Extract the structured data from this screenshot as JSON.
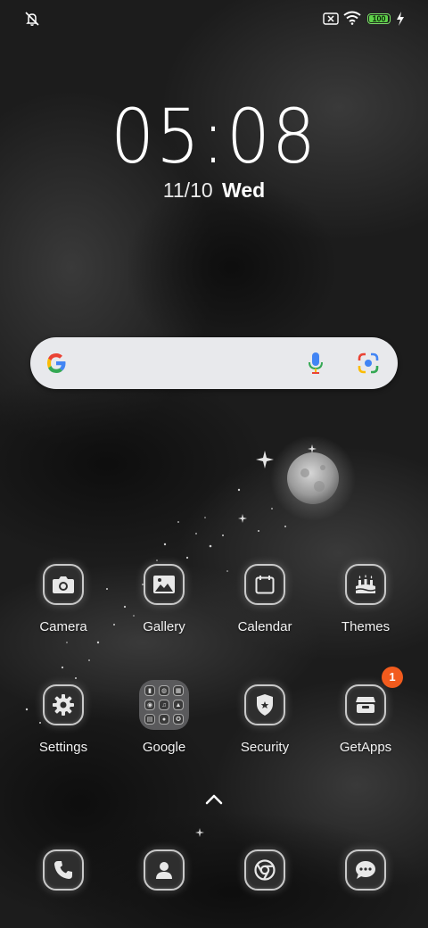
{
  "status_bar": {
    "left_icons": [
      "notifications-off-icon"
    ],
    "right_icons": [
      "no-sim-icon",
      "wifi-icon",
      "battery-icon",
      "charging-icon"
    ],
    "battery_level": "100"
  },
  "lock": {
    "time": "05:08",
    "date": "11/10",
    "weekday": "Wed"
  },
  "search": {
    "icons": [
      "google-logo-icon",
      "microphone-icon",
      "google-lens-icon"
    ]
  },
  "apps_row1": [
    {
      "label": "Camera",
      "icon": "camera-icon"
    },
    {
      "label": "Gallery",
      "icon": "gallery-icon"
    },
    {
      "label": "Calendar",
      "icon": "calendar-icon"
    },
    {
      "label": "Themes",
      "icon": "themes-icon"
    }
  ],
  "apps_row2": [
    {
      "label": "Settings",
      "icon": "settings-icon"
    },
    {
      "label": "Google",
      "icon": "folder-icon"
    },
    {
      "label": "Security",
      "icon": "security-icon"
    },
    {
      "label": "GetApps",
      "icon": "getapps-icon",
      "badge": "1"
    }
  ],
  "drawer_arrow": "chevron-up-icon",
  "dock": [
    {
      "icon": "phone-icon"
    },
    {
      "icon": "contacts-icon"
    },
    {
      "icon": "chrome-icon"
    },
    {
      "icon": "messages-icon"
    }
  ],
  "colors": {
    "badge": "#f25b1d",
    "battery": "#5fd34a",
    "search_bg": "#e8e9ec"
  }
}
